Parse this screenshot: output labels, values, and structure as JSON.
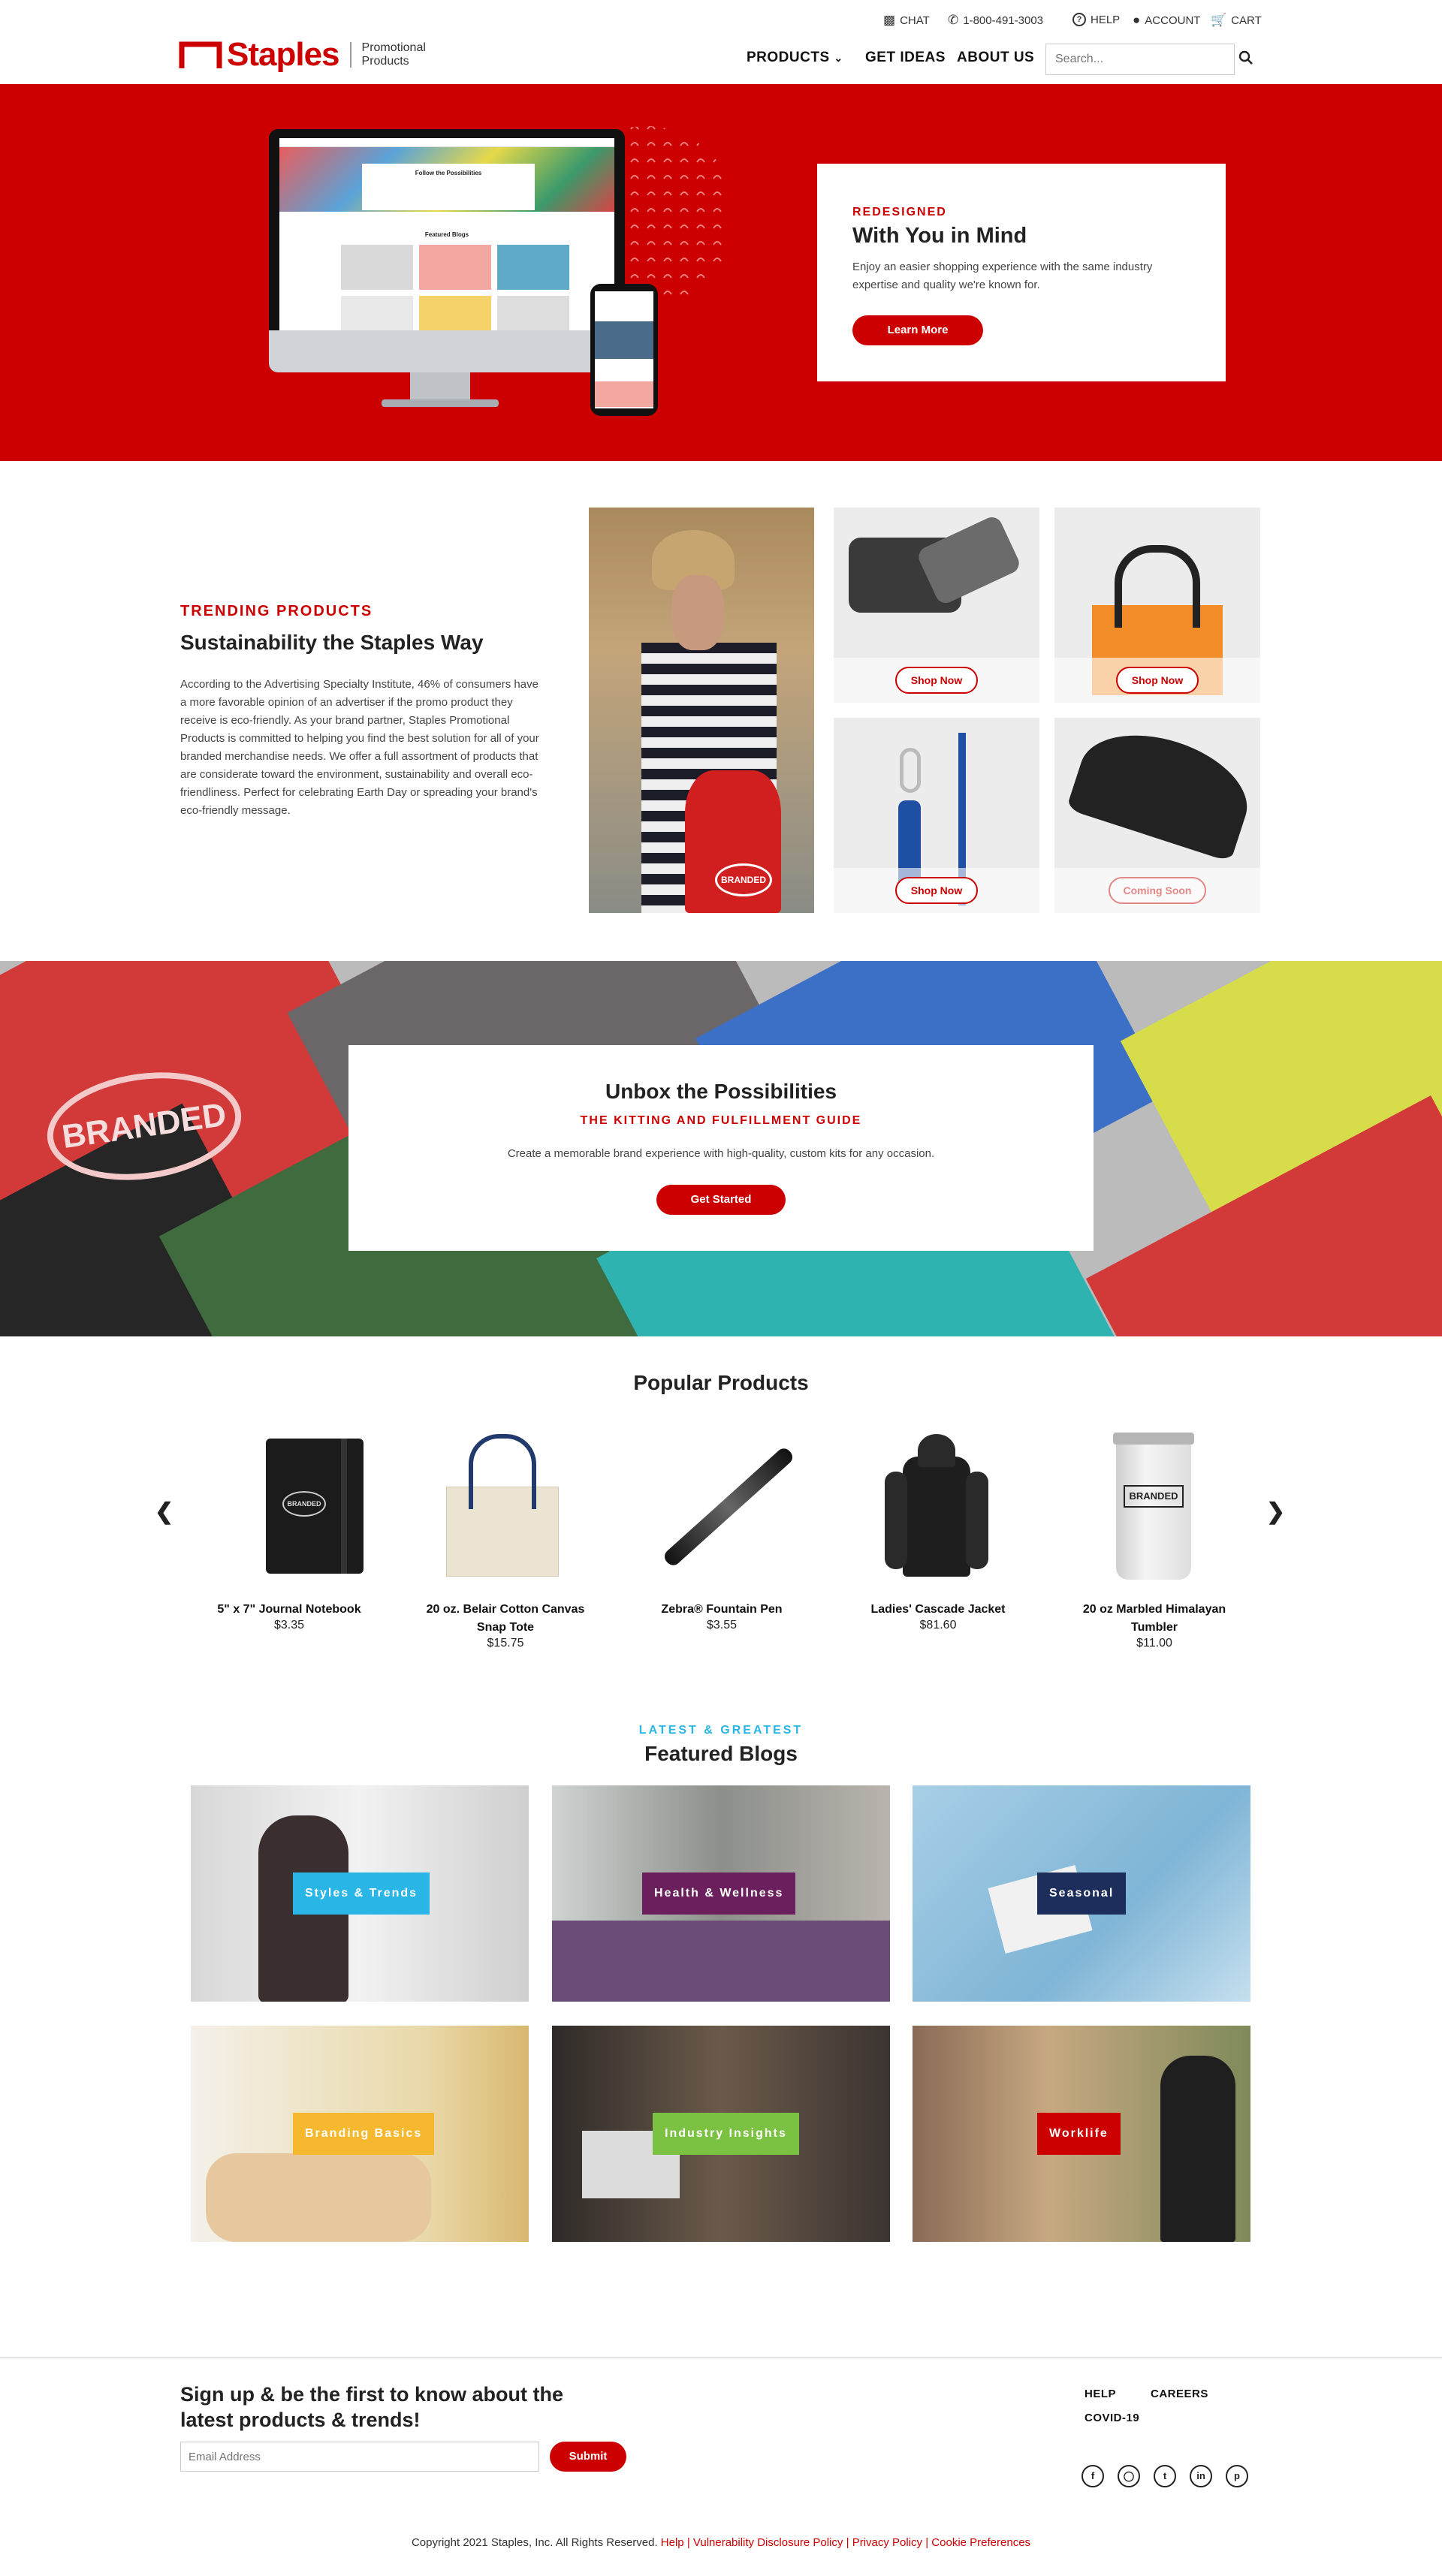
{
  "header": {
    "logo_text": "Staples",
    "logo_sub1": "Promotional",
    "logo_sub2": "Products",
    "util": {
      "chat": "CHAT",
      "phone": "1-800-491-3003",
      "help": "HELP",
      "account": "ACCOUNT",
      "cart": "CART"
    },
    "nav": {
      "products": "PRODUCTS",
      "ideas": "GET IDEAS",
      "about": "ABOUT US"
    },
    "search_placeholder": "Search..."
  },
  "hero": {
    "eyebrow": "REDESIGNED",
    "title": "With You in Mind",
    "text": "Enjoy an easier shopping experience with the same industry expertise and quality we're known for.",
    "cta": "Learn More",
    "screen": {
      "title": "Follow the Possibilities",
      "featured": "Featured Blogs"
    }
  },
  "trending": {
    "eyebrow": "TRENDING PRODUCTS",
    "title": "Sustainability the Staples Way",
    "text": "According to the Advertising Specialty Institute, 46% of consumers have a more favorable opinion of an advertiser if the promo product they receive is eco-friendly. As your brand partner, Staples Promotional Products is committed to helping you find the best solution for all of your branded merchandise needs. We offer a full assortment of products that are considerate toward the environment, sustainability and overall eco-friendliness. Perfect for celebrating Earth Day or spreading your brand's eco-friendly message.",
    "branded": "BRANDED",
    "shop_now": "Shop Now",
    "coming_soon": "Coming Soon"
  },
  "unbox": {
    "title": "Unbox the Possibilities",
    "subtitle": "THE KITTING AND FULFILLMENT GUIDE",
    "text": "Create a memorable brand experience with high-quality, custom kits for any occasion.",
    "cta": "Get Started",
    "branded": "BRANDED"
  },
  "popular": {
    "title": "Popular Products",
    "items": [
      {
        "name": "5\" x 7\" Journal Notebook",
        "price": "$3.35"
      },
      {
        "name": "20 oz. Belair Cotton Canvas Snap Tote",
        "price": "$15.75"
      },
      {
        "name": "Zebra® Fountain Pen",
        "price": "$3.55"
      },
      {
        "name": "Ladies' Cascade Jacket",
        "price": "$81.60"
      },
      {
        "name": "20 oz Marbled Himalayan Tumbler",
        "price": "$11.00"
      }
    ],
    "branded": "BRANDED"
  },
  "blogs": {
    "eyebrow": "LATEST & GREATEST",
    "title": "Featured Blogs",
    "tags": [
      "Styles & Trends",
      "Health & Wellness",
      "Seasonal",
      "Branding Basics",
      "Industry Insights",
      "Worklife"
    ],
    "colors": {
      "styles": "#29b6e6",
      "health": "#6b1f5c",
      "seasonal": "#1d2d5c",
      "branding": "#f5b82e",
      "industry": "#7cc242",
      "worklife": "#cc0000"
    }
  },
  "footer": {
    "signup_line1": "Sign up & be the first to know about the",
    "signup_line2": "latest products & trends!",
    "email_placeholder": "Email Address",
    "submit": "Submit",
    "links": {
      "help": "HELP",
      "careers": "CAREERS",
      "covid": "COVID-19"
    },
    "copyright": "Copyright  2021  Staples, Inc. All Rights Reserved.",
    "legal": [
      "Help",
      "Vulnerability Disclosure Policy",
      "Privacy Policy",
      "Cookie Preferences"
    ]
  },
  "colors": {
    "brand_red": "#cc0000",
    "accent_cyan": "#29b6e6"
  }
}
